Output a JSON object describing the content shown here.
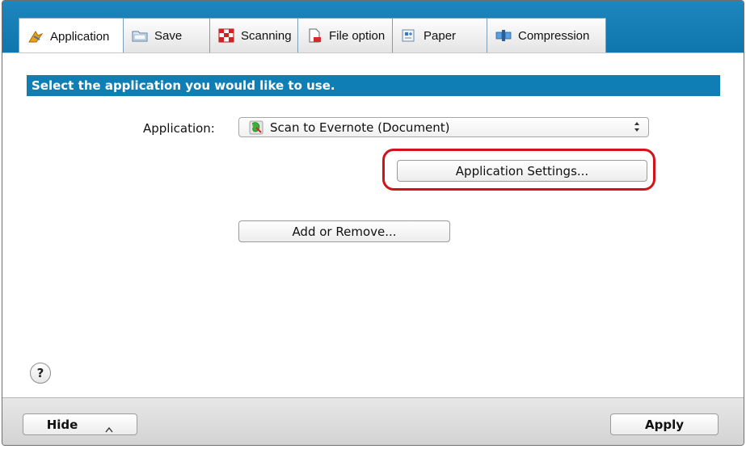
{
  "tabs": [
    {
      "label": "Application",
      "icon": "application-icon",
      "active": true
    },
    {
      "label": "Save",
      "icon": "folder-icon",
      "active": false
    },
    {
      "label": "Scanning",
      "icon": "scanning-icon",
      "active": false
    },
    {
      "label": "File option",
      "icon": "file-option-icon",
      "active": false
    },
    {
      "label": "Paper",
      "icon": "paper-icon",
      "active": false
    },
    {
      "label": "Compression",
      "icon": "compression-icon",
      "active": false
    }
  ],
  "main": {
    "header": "Select the application you would like to use.",
    "application_label": "Application:",
    "application_value": "Scan to Evernote (Document)",
    "settings_button": "Application Settings...",
    "add_remove_button": "Add or Remove...",
    "help_label": "?"
  },
  "footer": {
    "hide_button": "Hide",
    "apply_button": "Apply"
  },
  "colors": {
    "tabbar_blue": "#1e86bd",
    "header_blue": "#0e7eb4",
    "highlight_red": "#d4121a"
  }
}
